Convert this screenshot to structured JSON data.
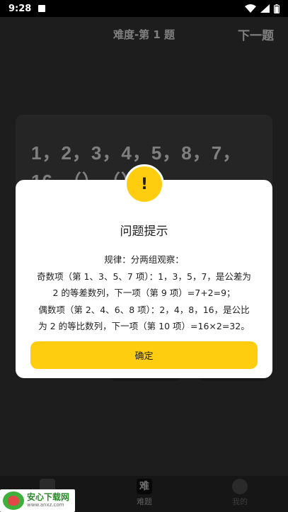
{
  "status_bar": {
    "time": "9:28"
  },
  "header": {
    "title": "难度-第 1 题",
    "next_label": "下一题"
  },
  "question": {
    "line1": "1，2，3，4，5，8，7，",
    "line2": "16，（），（）"
  },
  "dialog": {
    "badge": "!",
    "title": "问题提示",
    "body_lines": [
      "规律：分两组观察：",
      "奇数项（第 1、3、5、7 项）：1，3，5，7，是公差为",
      "2 的等差数列，下一项（第 9 项）=7+2=9；",
      "偶数项（第 2、4、6、8 项）：2，4，8，16，是公比",
      "为 2 的等比数列，下一项（第 10 项）=16×2=32。"
    ],
    "confirm_label": "确定"
  },
  "bottom_nav": {
    "items": [
      {
        "label": "",
        "icon": "book-icon"
      },
      {
        "label": "难题",
        "icon_text": "难"
      },
      {
        "label": "我的",
        "icon": "user-icon"
      }
    ]
  },
  "watermark": {
    "main": "安心下载网",
    "sub": "www.anxz.com"
  },
  "colors": {
    "accent": "#fecd10",
    "background": "#1f1f1f",
    "dialog": "#ffffff"
  }
}
